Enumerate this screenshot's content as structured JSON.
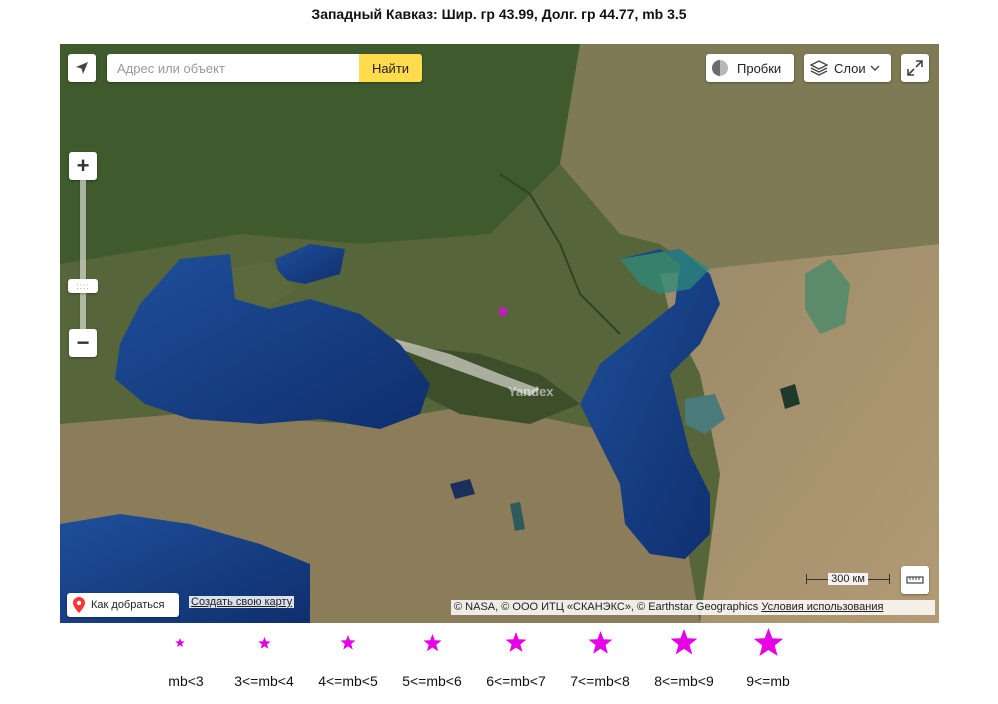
{
  "title": "Западный Кавказ: Шир. гр 43.99, Долг. гр 44.77, mb 3.5",
  "map": {
    "search_placeholder": "Адрес или объект",
    "search_value": "",
    "find_label": "Найти",
    "traffic_label": "Пробки",
    "layers_label": "Слои",
    "scale_label": "300 км",
    "route_label": "Как добраться",
    "create_map_label": "Создать свою карту",
    "attribution": "© NASA, © ООО ИТЦ «СКАНЭКС», © Earthstar Geographics",
    "terms_label": "Условия использования",
    "watermark": "Yandex",
    "marker_color": "#e600e6",
    "event": {
      "lat": 43.99,
      "lon": 44.77,
      "mb": 3.5
    }
  },
  "legend": {
    "star_color": "#e600e6",
    "items": [
      {
        "label": "mb<3"
      },
      {
        "label": "3<=mb<4"
      },
      {
        "label": "4<=mb<5"
      },
      {
        "label": "5<=mb<6"
      },
      {
        "label": "6<=mb<7"
      },
      {
        "label": "7<=mb<8"
      },
      {
        "label": "8<=mb<9"
      },
      {
        "label": "9<=mb"
      }
    ]
  }
}
